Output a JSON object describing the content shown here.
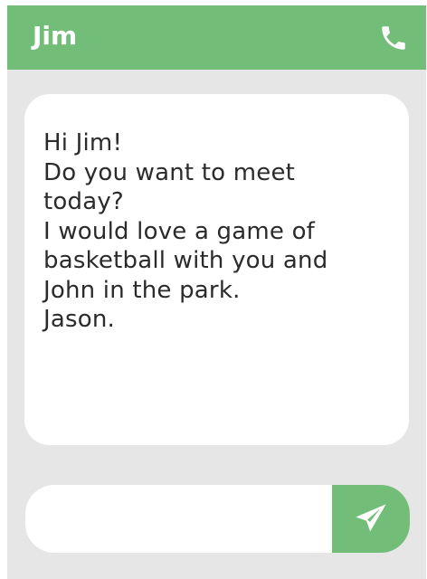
{
  "header": {
    "contact_name": "Jim",
    "call_icon": "phone-icon"
  },
  "message": {
    "lines": [
      "Hi Jim!",
      "Do you want to meet",
      "today?",
      "I would love a game of",
      "basketball with you and",
      "John in the park.",
      "Jason."
    ]
  },
  "composer": {
    "input_value": "",
    "send_icon": "paper-plane-icon"
  },
  "colors": {
    "accent": "#72be78",
    "background": "#e6e6e6",
    "bubble": "#ffffff",
    "text": "#2b2b2b"
  }
}
